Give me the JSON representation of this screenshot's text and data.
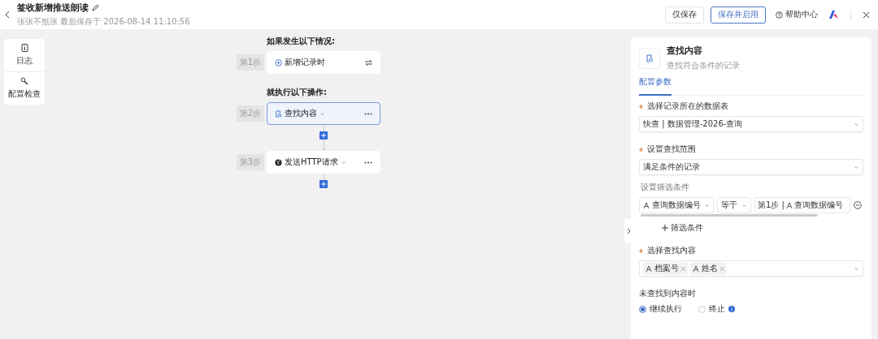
{
  "header": {
    "title": "签收新增推送朗读",
    "subtitle": "张张不抵张 最后保存于 2026-08-14 11:10:56",
    "buttons": [
      {
        "label": "仅保存",
        "kind": "plain"
      },
      {
        "label": "保存并启用",
        "kind": "primary"
      }
    ],
    "help": "帮助中心"
  },
  "sidebar": {
    "items": [
      {
        "label": "日志",
        "kind": "log"
      },
      {
        "label": "配置检查",
        "kind": "check"
      }
    ]
  },
  "flow": {
    "sections": [
      {
        "heading": "如果发生以下情况:",
        "steps": [
          {
            "step": "第1步",
            "label": "新增记录时",
            "kind": "trigger",
            "selected": false
          }
        ]
      },
      {
        "heading": "就执行以下操作:",
        "steps": [
          {
            "step": "第2步",
            "label": "查找内容",
            "kind": "find",
            "selected": true
          },
          {
            "step": "第3步",
            "label": "发送HTTP请求",
            "kind": "http",
            "selected": false
          }
        ]
      }
    ]
  },
  "panel": {
    "title": "查找内容",
    "subtitle": "查找符合条件的记录",
    "tabs": [
      {
        "label": "配置参数",
        "selected": true
      }
    ],
    "fields": [
      {
        "kind": "select",
        "required": true,
        "label": "选择记录所在的数据表",
        "value": "快查 | 数据管理-2026-查询"
      },
      {
        "kind": "select",
        "required": true,
        "label": "设置查找范围",
        "value": "满足条件的记录"
      },
      {
        "kind": "filter",
        "required": false,
        "label": "设置筛选条件",
        "field": "查询数据编号",
        "operator": "等于",
        "value_step": "第1步 |",
        "value_field": "查询数据编号",
        "add": "筛选条件"
      },
      {
        "kind": "tags",
        "required": true,
        "label": "选择查找内容",
        "tags": [
          "档案号",
          "姓名"
        ]
      },
      {
        "kind": "radio",
        "required": false,
        "label": "未查找到内容时",
        "options": [
          {
            "label": "继续执行",
            "selected": true,
            "info": false
          },
          {
            "label": "终止",
            "selected": false,
            "info": true
          }
        ]
      }
    ]
  }
}
